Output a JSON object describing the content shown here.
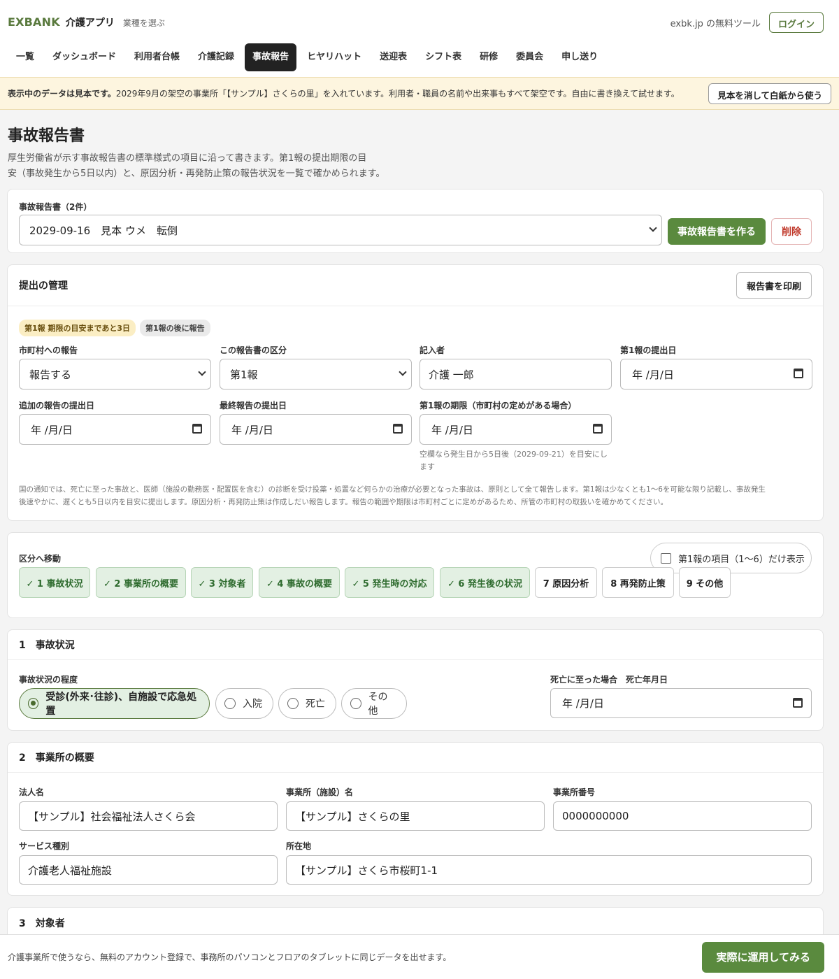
{
  "header": {
    "logo": "EXBANK",
    "app": "介護アプリ",
    "picker": "業種を選ぶ",
    "site": "exbk.jp の無料ツール",
    "login": "ログイン"
  },
  "nav": [
    "一覧",
    "ダッシュボード",
    "利用者台帳",
    "介護記録",
    "事故報告",
    "ヒヤリハット",
    "送迎表",
    "シフト表",
    "研修",
    "委員会",
    "申し送り"
  ],
  "nav_active": "事故報告",
  "banner": {
    "bold": "表示中のデータは見本です。",
    "text": "2029年9月の架空の事業所「【サンプル】さくらの里」を入れています。利用者・職員の名前や出来事もすべて架空です。自由に書き換えて試せます。",
    "button": "見本を消して白紙から使う"
  },
  "page": {
    "title": "事故報告書",
    "desc1": "厚生労働省が示す事故報告書の標準様式の項目に沿って書きます。第1報の提出期限の目",
    "desc2": "安（事故発生から5日以内）と、原因分析・再発防止策の報告状況を一覧で確かめられます。"
  },
  "selector": {
    "label": "事故報告書（2件）",
    "value": "2029-09-16　見本 ウメ　転倒",
    "create": "事故報告書を作る",
    "delete": "削除"
  },
  "submission": {
    "title": "提出の管理",
    "print": "報告書を印刷",
    "badges": [
      "第1報 期限の目安まであと3日",
      "第1報の後に報告"
    ],
    "municipal_label": "市町村への報告",
    "municipal_value": "報告する",
    "kind_label": "この報告書の区分",
    "kind_value": "第1報",
    "writer_label": "記入者",
    "writer_value": "介護 一郎",
    "first_date_label": "第1報の提出日",
    "first_date_value": "年 /月/日",
    "add_date_label": "追加の報告の提出日",
    "add_date_value": "年 /月/日",
    "final_date_label": "最終報告の提出日",
    "final_date_value": "年 /月/日",
    "deadline_label": "第1報の期限（市町村の定めがある場合）",
    "deadline_value": "年 /月/日",
    "deadline_hint1": "空欄なら発生日から5日後（2029-09-21）を目安にし",
    "deadline_hint2": "ます",
    "note1": "国の通知では、死亡に至った事故と、医師（施設の勤務医・配置医を含む）の診断を受け投薬・処置など何らかの治療が必要となった事故は、原則として全て報告します。第1報は少なくとも1〜6を可能な限り記載し、事故発生",
    "note2": "後速やかに、遅くとも5日以内を目安に提出します。原因分析・再発防止策は作成しだい報告します。報告の範囲や期限は市町村ごとに定めがあるため、所管の市町村の取扱いを確かめてください。"
  },
  "jump": {
    "title": "区分へ移動",
    "toggle": "第1報の項目（1〜6）だけ表示",
    "items": [
      "✓ 1 事故状況",
      "✓ 2 事業所の概要",
      "✓ 3 対象者",
      "✓ 4 事故の概要",
      "✓ 5 発生時の対応",
      "✓ 6 発生後の状況",
      "7 原因分析",
      "8 再発防止策",
      "9 その他"
    ]
  },
  "sec1": {
    "title": "1　事故状況",
    "degree_label": "事故状況の程度",
    "options": [
      "受診(外来･往診)、自施設で応急処置",
      "入院",
      "死亡",
      "その他"
    ],
    "death_label": "死亡に至った場合　死亡年月日",
    "death_value": "年 /月/日"
  },
  "sec2": {
    "title": "2　事業所の概要",
    "corp_label": "法人名",
    "corp_value": "【サンプル】社会福祉法人さくら会",
    "office_label": "事業所（施設）名",
    "office_value": "【サンプル】さくらの里",
    "num_label": "事業所番号",
    "num_value": "0000000000",
    "svc_label": "サービス種別",
    "svc_value": "介護老人福祉施設",
    "addr_label": "所在地",
    "addr_value": "【サンプル】さくら市桜町1-1"
  },
  "sec3": {
    "title": "3　対象者"
  },
  "footer": {
    "text": "介護事業所で使うなら、無料のアカウント登録で、事務所のパソコンとフロアのタブレットに同じデータを出せます。",
    "button": "実際に運用してみる"
  }
}
